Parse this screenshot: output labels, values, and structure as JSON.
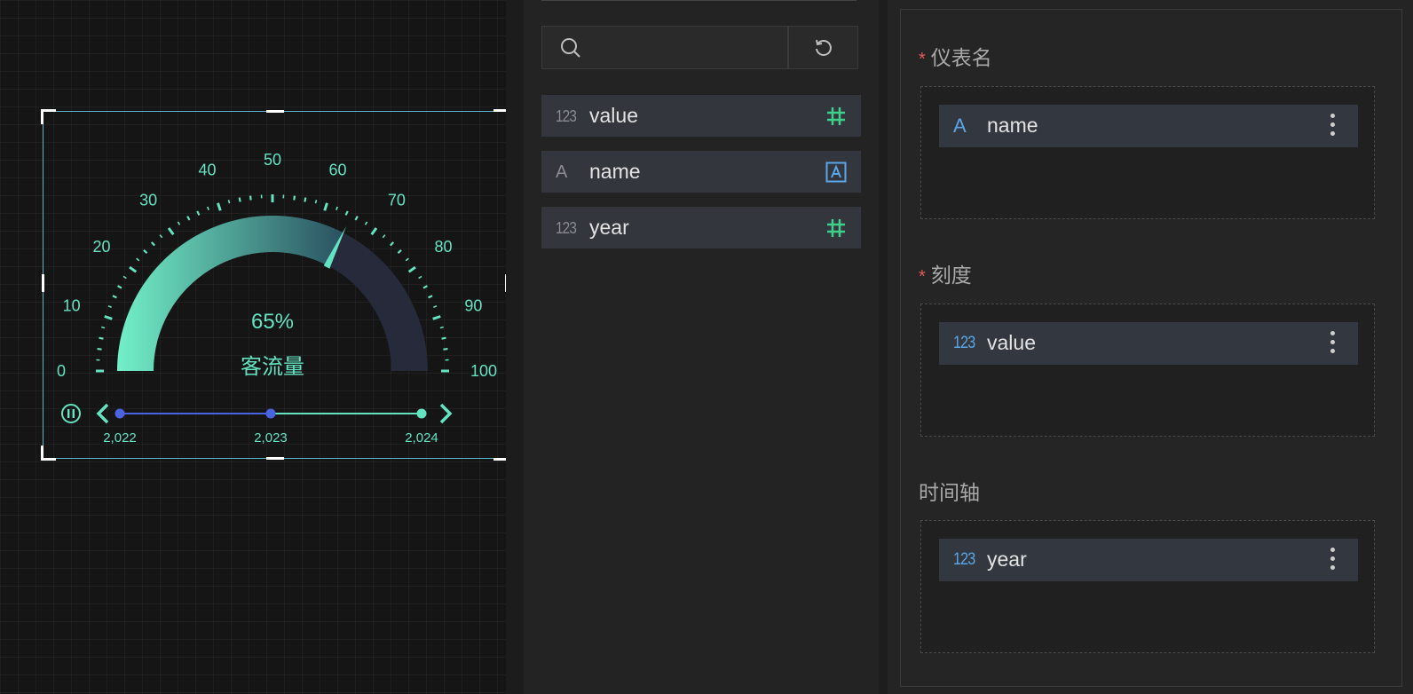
{
  "gauge": {
    "center_value": "65%",
    "center_label": "客流量",
    "scale_labels": [
      "0",
      "10",
      "20",
      "30",
      "40",
      "50",
      "60",
      "70",
      "80",
      "90",
      "100"
    ],
    "value_fraction": 0.65,
    "timeline": {
      "years": [
        "2,022",
        "2,023",
        "2,024"
      ],
      "current_index": 1
    },
    "colors": {
      "accent": "#64e3c0",
      "track": "#262a3a",
      "timeline_active": "#4a63e0"
    }
  },
  "fields_panel": {
    "search": {
      "placeholder": "",
      "icon": "search-icon"
    },
    "refresh_icon": "refresh-icon",
    "items": [
      {
        "type": "123",
        "label": "value",
        "end_icon": "hash-icon"
      },
      {
        "type": "A",
        "label": "name",
        "end_icon": "text-box-icon"
      },
      {
        "type": "123",
        "label": "year",
        "end_icon": "hash-icon"
      }
    ]
  },
  "config_panel": {
    "sections": [
      {
        "required": true,
        "required_mark": "*",
        "title": "仪表名",
        "chip": {
          "type": "A",
          "label": "name"
        }
      },
      {
        "required": true,
        "required_mark": "*",
        "title": "刻度",
        "chip": {
          "type": "123",
          "label": "value"
        }
      },
      {
        "required": false,
        "required_mark": "",
        "title": "时间轴",
        "chip": {
          "type": "123",
          "label": "year"
        }
      }
    ]
  }
}
